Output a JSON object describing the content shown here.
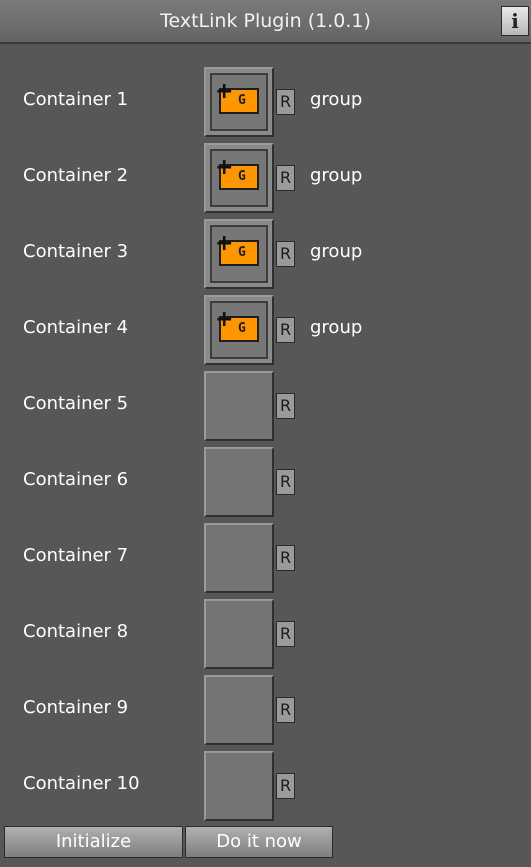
{
  "window": {
    "title": "TextLink Plugin (1.0.1)",
    "info_label": "i"
  },
  "containers": [
    {
      "label": "Container  1",
      "reset_label": "R",
      "has_group": true,
      "group_label": "group",
      "group_icon": "group-G-icon"
    },
    {
      "label": "Container  2",
      "reset_label": "R",
      "has_group": true,
      "group_label": "group",
      "group_icon": "group-G-icon"
    },
    {
      "label": "Container  3",
      "reset_label": "R",
      "has_group": true,
      "group_label": "group",
      "group_icon": "group-G-icon"
    },
    {
      "label": "Container  4",
      "reset_label": "R",
      "has_group": true,
      "group_label": "group",
      "group_icon": "group-G-icon"
    },
    {
      "label": "Container  5",
      "reset_label": "R",
      "has_group": false
    },
    {
      "label": "Container  6",
      "reset_label": "R",
      "has_group": false
    },
    {
      "label": "Container  7",
      "reset_label": "R",
      "has_group": false
    },
    {
      "label": "Container  8",
      "reset_label": "R",
      "has_group": false
    },
    {
      "label": "Container  9",
      "reset_label": "R",
      "has_group": false
    },
    {
      "label": "Container 10",
      "reset_label": "R",
      "has_group": false
    }
  ],
  "buttons": {
    "initialize": "Initialize",
    "do_it_now": "Do it now"
  },
  "colors": {
    "panel_background": "#575757",
    "group_icon_fill": "#ff9600"
  }
}
